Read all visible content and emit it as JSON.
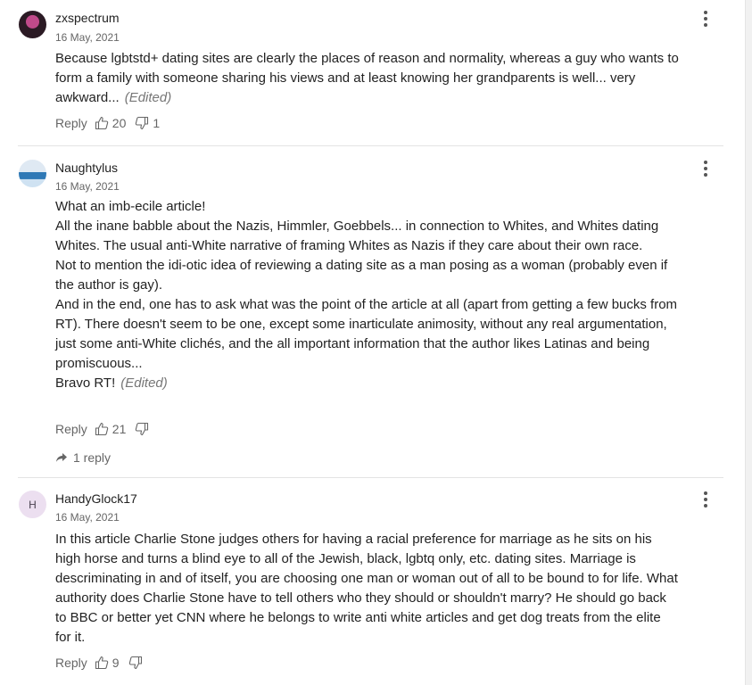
{
  "comments": [
    {
      "username": "zxspectrum",
      "date": "16 May, 2021",
      "body": "Because lgbtstd+ dating sites are clearly the places of reason and normality, whereas a guy who wants to form a family with someone sharing his views and at least knowing her grandparents is well... very awkward...",
      "edited": "(Edited)",
      "reply_label": "Reply",
      "likes": "20",
      "dislikes": "1"
    },
    {
      "username": "Naughtylus",
      "date": "16 May, 2021",
      "body_lines": [
        "What an imb-ecile article!",
        "All the inane babble about the Nazis, Himmler, Goebbels... in connection to Whites, and Whites dating Whites. The usual anti-White narrative of framing Whites as Nazis if they care about their own race.",
        "Not to mention the idi-otic idea of reviewing a dating site as a man posing as a woman (probably even if the author is gay).",
        "And in the end, one has to ask what was the point of the article at all (apart from getting a few bucks from RT). There doesn't seem to be one, except some inarticulate animosity, without any real argumentation, just some anti-White clichés, and the all important information that the author likes Latinas and being promiscuous...",
        "Bravo RT!"
      ],
      "edited": "(Edited)",
      "reply_label": "Reply",
      "likes": "21",
      "dislikes": "",
      "replies": "1 reply"
    },
    {
      "username": "HandyGlock17",
      "avatar_letter": "H",
      "date": "16 May, 2021",
      "body": "In this article Charlie Stone judges others for having a racial preference for marriage as he sits on his high horse and turns a blind eye to all of the Jewish, black, lgbtq only, etc. dating sites. Marriage is descriminating in and of itself, you are choosing one man or woman out of all to be bound to for life. What authority does Charlie Stone have to tell others who they should or shouldn't marry? He should go back to BBC or better yet CNN where he belongs to write anti white articles and get dog treats from the elite for it.",
      "reply_label": "Reply",
      "likes": "9",
      "dislikes": ""
    }
  ],
  "icons": {
    "like": "thumbs-up-icon",
    "dislike": "thumbs-down-icon",
    "menu": "more-vertical-icon",
    "reply_arrow": "reply-arrow-icon"
  }
}
